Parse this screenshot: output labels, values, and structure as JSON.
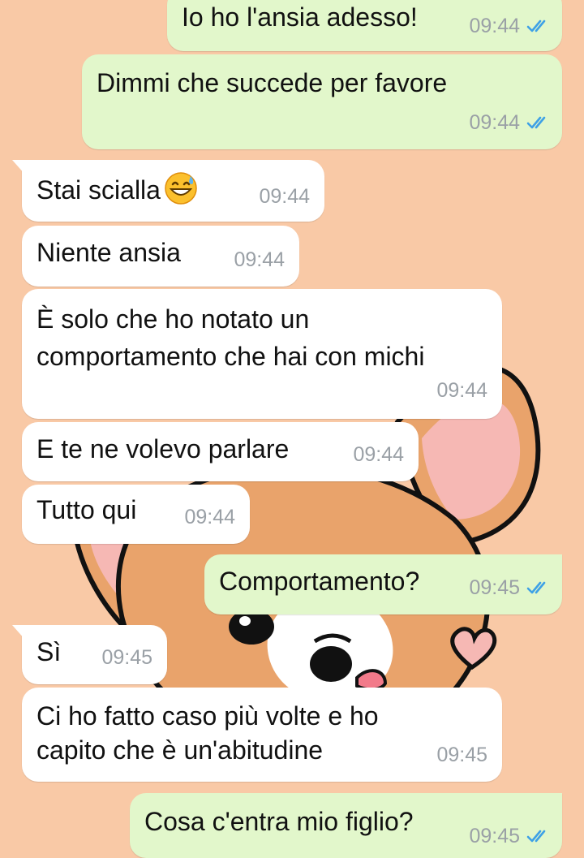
{
  "chat": {
    "messages": [
      {
        "side": "out",
        "text": "Io ho l'ansia adesso!",
        "time": "09:44",
        "status": "read-double-check-icon"
      },
      {
        "side": "out",
        "text": "Dimmi che succede per favore",
        "time": "09:44",
        "status": "read-double-check-icon"
      },
      {
        "side": "in",
        "text": "Stai scialla",
        "emoji": "grinning-sweat-emoji",
        "time": "09:44"
      },
      {
        "side": "in",
        "text": "Niente ansia",
        "time": "09:44"
      },
      {
        "side": "in",
        "text": "È solo che ho notato un\ncomportamento che hai con michi",
        "time": "09:44"
      },
      {
        "side": "in",
        "text": "E te ne volevo parlare",
        "time": "09:44"
      },
      {
        "side": "in",
        "text": "Tutto qui",
        "time": "09:44"
      },
      {
        "side": "out",
        "text": "Comportamento?",
        "time": "09:45",
        "status": "read-double-check-icon"
      },
      {
        "side": "in",
        "text": "Sì",
        "time": "09:45"
      },
      {
        "side": "in",
        "text": "Ci ho fatto caso più volte e ho\ncapito che è un'abitudine",
        "time": "09:45"
      },
      {
        "side": "out",
        "text": "Cosa c'entra mio figlio?",
        "time": "09:45",
        "status": "read-double-check-icon"
      }
    ]
  },
  "colors": {
    "wallpaper": "#f9c9a6",
    "incoming_bubble": "#ffffff",
    "outgoing_bubble": "#e2f7cb",
    "timestamp": "#9aa0a6",
    "read_ticks": "#3ea1e6"
  },
  "wallpaper_icons": [
    "chihuahua-illustration",
    "heart-icon"
  ]
}
